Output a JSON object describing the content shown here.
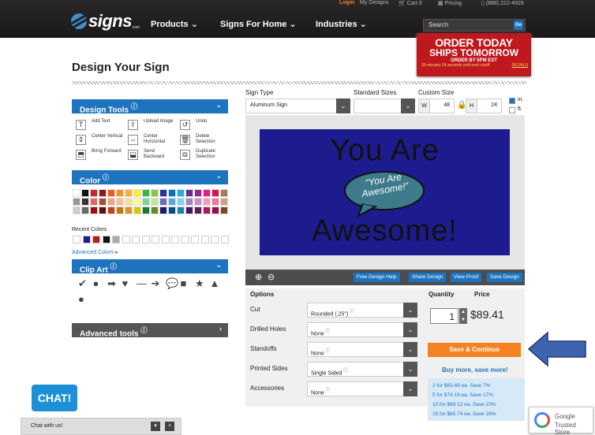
{
  "topbar": {
    "login": "Login",
    "my_designs": "My Designs",
    "cart": "Cart 0",
    "pricing": "Pricing",
    "phone": "(888) 222-4929"
  },
  "brand": {
    "name": "signs",
    "suffix": ".com"
  },
  "nav": {
    "products": "Products",
    "signs_home": "Signs For Home",
    "industries": "Industries"
  },
  "search": {
    "placeholder": "Search",
    "go": "Go"
  },
  "promo": {
    "line1": "ORDER TODAY",
    "line2": "SHIPS TOMORROW",
    "line3": "ORDER BY 5PM EST",
    "line4": "35 minutes 24 seconds until next cutoff",
    "details": "DETAILS"
  },
  "page_title": "Design Your Sign",
  "design_tools": {
    "title": "Design Tools",
    "tools": [
      {
        "icon": "T",
        "label": "Add Text"
      },
      {
        "icon": "⇪",
        "label": "Upload Image"
      },
      {
        "icon": "↺",
        "label": "Undo"
      },
      {
        "icon": "⇕",
        "label": "Center Vertical"
      },
      {
        "icon": "⇔",
        "label": "Center Horizontal"
      },
      {
        "icon": "🗑",
        "label": "Delete Selection"
      },
      {
        "icon": "⬒",
        "label": "Bring Forward"
      },
      {
        "icon": "⬓",
        "label": "Send Backward"
      },
      {
        "icon": "⧉",
        "label": "Duplicate Selection"
      }
    ]
  },
  "color": {
    "title": "Color",
    "recent_label": "Recent Colors",
    "advanced_label": "Advanced Colors ▸"
  },
  "clip_art": {
    "title": "Clip Art",
    "icons": [
      "✔",
      "●",
      "➡",
      "♥",
      "—",
      "➔",
      "💬",
      "■",
      "★",
      "▲",
      "●"
    ]
  },
  "advanced_tools": {
    "title": "Advanced tools"
  },
  "sign_type": {
    "label": "Sign Type",
    "value": "Aluminum Sign"
  },
  "standard_sizes": {
    "label": "Standard Sizes",
    "value": ""
  },
  "custom_size": {
    "label": "Custom Size",
    "w_label": "W",
    "w": "48",
    "h_label": "H",
    "h": "24",
    "unit_in": "in.",
    "unit_ft": "ft."
  },
  "sign": {
    "line1": "You Are",
    "line2": "Awesome!",
    "bubble1": "“You Are",
    "bubble2": "Awesome!”"
  },
  "canvas_toolbar": {
    "free_help": "Free Design Help",
    "share": "Share Design",
    "view_proof": "View Proof",
    "save_design": "Save Design"
  },
  "options": {
    "header": "Options",
    "rows": [
      {
        "label": "Cut",
        "value": "Rounded (.25\")"
      },
      {
        "label": "Drilled Holes",
        "value": "None"
      },
      {
        "label": "Standoffs",
        "value": "None"
      },
      {
        "label": "Printed Sides",
        "value": "Single Sided"
      },
      {
        "label": "Accessories",
        "value": "None"
      }
    ]
  },
  "order": {
    "quantity_label": "Quantity",
    "price_label": "Price",
    "quantity": "1",
    "price": "$89.41",
    "save_continue": "Save & Continue",
    "buy_more": "Buy more, save more!",
    "tiers": [
      "2 for $83.49 ea. Save 7%",
      "5 for $74.19 ea. Save 17%",
      "10 for $69.12 ea. Save 23%",
      "15 for $65.74 ea. Save 26%"
    ]
  },
  "chat": {
    "bubble": "CHAT!",
    "bar": "Chat with us!"
  },
  "badge": {
    "line1": "Google",
    "line2": "Trusted Store"
  },
  "colors": {
    "accent": "#1e73be",
    "orange": "#f58220",
    "promo_red": "#c0181f",
    "sign_bg": "#1c1c8e"
  }
}
